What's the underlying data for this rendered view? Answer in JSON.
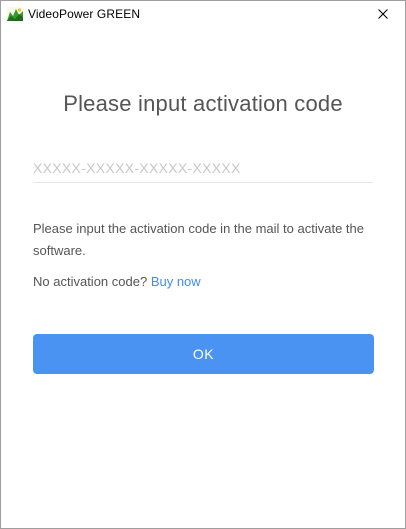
{
  "window": {
    "title": "VideoPower GREEN"
  },
  "dialog": {
    "heading": "Please input activation code",
    "code_placeholder": "XXXXX-XXXXX-XXXXX-XXXXX",
    "code_value": "",
    "description": "Please input the activation code in the mail to activate the software.",
    "no_code_text": "No activation code?",
    "buy_link_label": "Buy now",
    "ok_label": "OK"
  },
  "colors": {
    "accent": "#4b93f2",
    "link": "#3d8ef0",
    "text": "#555555"
  },
  "icons": {
    "app": "videopower-green-app-icon",
    "close": "close-icon"
  }
}
